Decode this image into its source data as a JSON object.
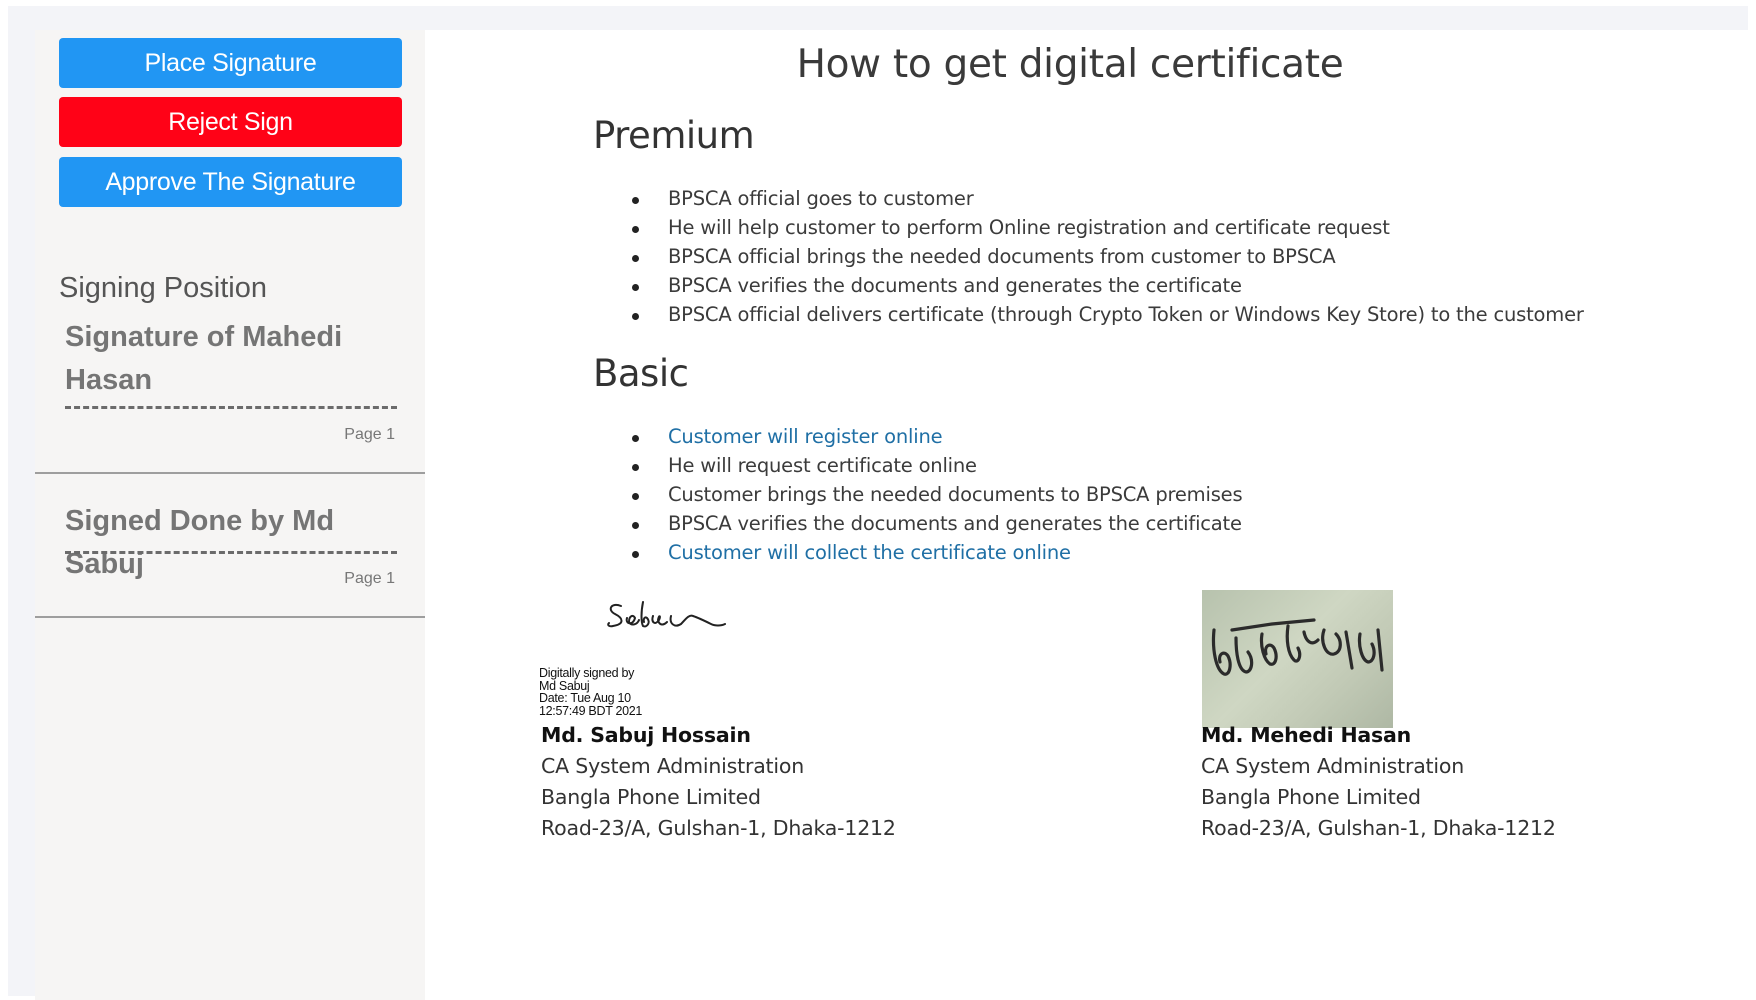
{
  "sidebar": {
    "buttons": {
      "place_signature": "Place Signature",
      "reject_sign": "Reject Sign",
      "approve_signature": "Approve The Signature"
    },
    "signing_position_title": "Signing Position",
    "entries": [
      {
        "name": "Signature of Mahedi Hasan",
        "page": "Page 1"
      },
      {
        "name": "Signed Done by Md Sabuj",
        "page": "Page 1"
      }
    ]
  },
  "document": {
    "title": "How to get digital certificate",
    "premium": {
      "heading": "Premium",
      "items": [
        "BPSCA official goes to customer",
        "He will help customer to perform Online registration and certificate request",
        "BPSCA official brings the needed documents from customer to BPSCA",
        "BPSCA verifies the documents and generates the certificate",
        "BPSCA official delivers certificate (through Crypto Token or Windows Key Store) to the customer"
      ]
    },
    "basic": {
      "heading": "Basic",
      "items": [
        "Customer will register online",
        "He will request certificate online",
        "Customer brings the needed documents to BPSCA premises",
        "BPSCA verifies the documents and generates the certificate",
        "Customer will collect the certificate online"
      ]
    },
    "signers": [
      {
        "name": "Md. Sabuj Hossain",
        "role": "CA System Administration",
        "company": "Bangla Phone Limited",
        "address": "Road-23/A, Gulshan-1, Dhaka-1212",
        "handwritten": "Sabuj",
        "digital_stamp": [
          "Digitally signed by",
          "Md Sabuj",
          "Date: Tue Aug 10",
          "12:57:49 BDT 2021"
        ]
      },
      {
        "name": "Md. Mehedi Hasan",
        "role": "CA System Administration",
        "company": "Bangla Phone Limited",
        "address": "Road-23/A, Gulshan-1, Dhaka-1212",
        "handwritten": "মেহেদী হাসান"
      }
    ]
  },
  "colors": {
    "primary_button": "#2196f3",
    "reject_button": "#ff0217",
    "link": "#1f6fa5",
    "sidebar_bg": "#f6f5f4"
  }
}
